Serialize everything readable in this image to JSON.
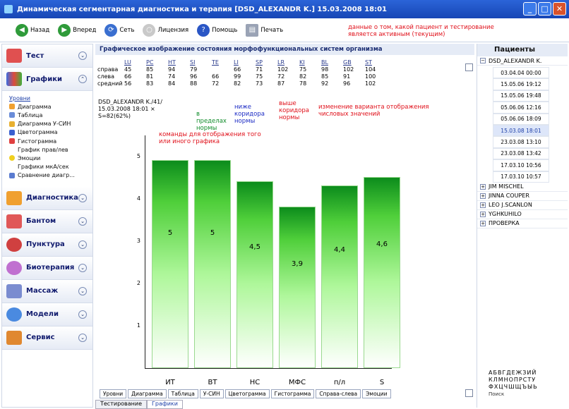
{
  "window": {
    "title": "Динамическая сегментарная диагностика и терапия [DSD_ALEXANDR K.] 15.03.2008 18:01"
  },
  "toolbar": {
    "back": "Назад",
    "forward": "Вперед",
    "net": "Сеть",
    "license": "Лицензия",
    "help": "Помощь",
    "print": "Печать"
  },
  "sidebar": {
    "sections": [
      "Тест",
      "Графики",
      "Диагностика",
      "Бантом",
      "Пунктура",
      "Биотерапия",
      "Массаж",
      "Модели",
      "Сервис"
    ],
    "items": [
      "Уровни",
      "Диаграмма",
      "Таблица",
      "Диаграмма У-СИН",
      "Цветограмма",
      "Гистограмма",
      "График прав/лев",
      "Эмоции",
      "Графики мкА/сек",
      "Сравнение диагр..."
    ]
  },
  "main": {
    "title": "Графическое изображение состояния морфофункциональных систем организма",
    "columns": [
      "LU",
      "PC",
      "HT",
      "SI",
      "TE",
      "LI",
      "SP",
      "LR",
      "KI",
      "BL",
      "GB",
      "ST"
    ],
    "rows": [
      {
        "label": "справа",
        "values": [
          "45",
          "85",
          "94",
          "79",
          "",
          "66",
          "71",
          "102",
          "75",
          "98",
          "102",
          "104"
        ]
      },
      {
        "label": "слева",
        "values": [
          "66",
          "81",
          "74",
          "96",
          "66",
          "99",
          "75",
          "72",
          "82",
          "85",
          "91",
          "100"
        ]
      },
      {
        "label": "средний",
        "values": [
          "56",
          "83",
          "84",
          "88",
          "72",
          "82",
          "73",
          "87",
          "78",
          "92",
          "96",
          "102"
        ]
      }
    ],
    "info": [
      "DSD_ALEXANDR K./41/",
      "15.03.2008 18:01 ×",
      "S=82(62%)"
    ],
    "bottom_tabs": [
      "Уровни",
      "Диаграмма",
      "Таблица",
      "У-СИН",
      "Цветограмма",
      "Гистограмма",
      "Справа-слева",
      "Эмоции"
    ]
  },
  "annotations": {
    "active": "данные о том, какой пациент и тестирование является активным (текущим)",
    "norm": "в пределах нормы",
    "below": "ниже коридора нормы",
    "above": "выше коридора нормы",
    "switch": "изменение варианта отображения числовых значений",
    "commands": "команды для отображения того или иного графика"
  },
  "chart_data": {
    "type": "bar",
    "categories": [
      "ИТ",
      "ВТ",
      "НС",
      "МФС",
      "п/л",
      "S"
    ],
    "values": [
      5,
      5,
      4.5,
      3.9,
      4.4,
      4.6
    ],
    "labels": [
      "5",
      "5",
      "4,5",
      "3,9",
      "4,4",
      "4,6"
    ],
    "ylim": [
      0,
      5.5
    ],
    "yticks": [
      "5",
      "4",
      "3",
      "2",
      "1"
    ]
  },
  "patients": {
    "title": "Пациенты",
    "active": "DSD_ALEXANDR K.",
    "dates": [
      "03.04.04 00:00",
      "15.05.06 19:12",
      "15.05.06 19:48",
      "05.06.06 12:16",
      "05.06.06 18:09",
      "15.03.08 18:01",
      "23.03.08 13:10",
      "23.03.08 13:42",
      "17.03.10 10:56",
      "17.03.10 10:57"
    ],
    "others": [
      "JIM MISCHEL",
      "JINNA COUPER",
      "LEO J.SCANLON",
      "YGHKUHILO",
      "ПРОВЕРКА"
    ]
  },
  "keyboard": {
    "rows": [
      "АБВГДЕЖЗИЙ",
      "КЛМНОПРСТУ",
      "ФХЦЧШЩЪЫЬ"
    ],
    "search": "Поиск"
  },
  "statusbar": {
    "tabs": [
      "Тестирование",
      "Графики"
    ]
  }
}
